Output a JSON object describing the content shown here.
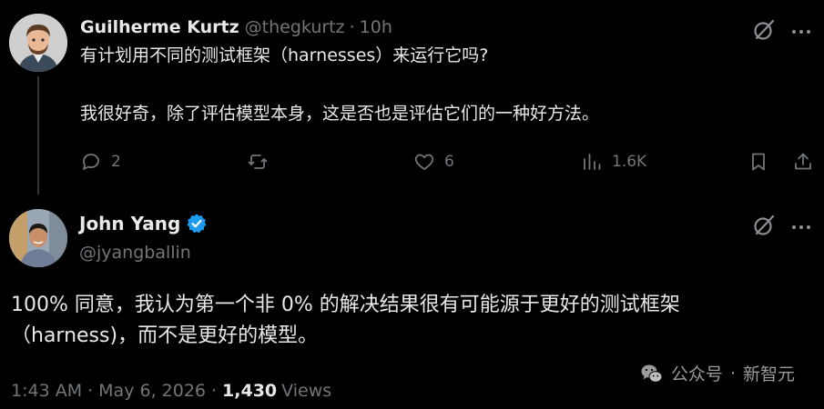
{
  "reply": {
    "author_name": "Guilherme Kurtz",
    "author_handle": "@thegkurtz",
    "separator": "·",
    "time": "10h",
    "text_lines": [
      "有计划用不同的测试框架（harnesses）来运行它吗?",
      "我很好奇，除了评估模型本身，这是否也是评估它们的一种好方法。"
    ],
    "actions": {
      "replies": "2",
      "reposts": "",
      "likes": "6",
      "views": "1.6K"
    }
  },
  "main_tweet": {
    "author_name": "John Yang",
    "author_handle": "@jyangballin",
    "verified": true,
    "text_lines": [
      "100% 同意，我认为第一个非 0% 的解决结果很有可能源于更好的测试框架",
      "（harness)，而不是更好的模型。"
    ],
    "time": "1:43 AM",
    "separator": "·",
    "date": "May 6, 2026",
    "views_count": "1,430",
    "views_label": "Views"
  },
  "watermark": {
    "label_left": "公众号",
    "dot": "·",
    "label_right": "新智元"
  },
  "colors": {
    "background": "#000000",
    "text": "#e7e9ea",
    "muted": "#71767b",
    "verified": "#1d9bf0"
  },
  "icons": [
    "reply-icon",
    "repost-icon",
    "like-icon",
    "views-icon",
    "bookmark-icon",
    "share-icon",
    "grok-icon",
    "more-icon",
    "verified-badge-icon",
    "wechat-icon"
  ]
}
